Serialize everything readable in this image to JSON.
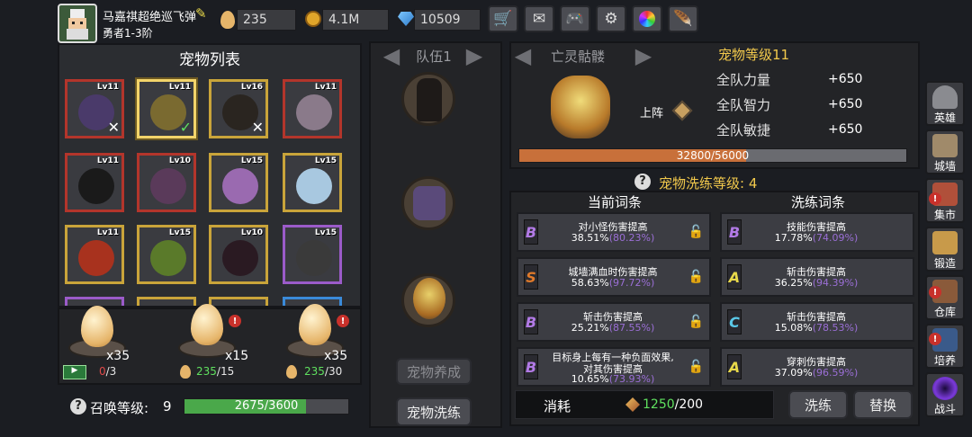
{
  "player": {
    "name": "马嘉祺超绝巡飞弹",
    "rank": "勇者1-3阶"
  },
  "currency": {
    "eggs": "235",
    "gold": "4.1M",
    "gems": "10509"
  },
  "toolbar_icons": [
    "shop-icon",
    "mail-icon",
    "gamepad-icon",
    "gear-icon",
    "shutter-icon",
    "feather-icon"
  ],
  "pet_list": {
    "title": "宠物列表",
    "slots": [
      {
        "level": "Lv11",
        "mark": "✕"
      },
      {
        "level": "Lv11",
        "mark": "✓"
      },
      {
        "level": "Lv16",
        "mark": "✕"
      },
      {
        "level": "Lv11",
        "mark": ""
      },
      {
        "level": "Lv11",
        "mark": ""
      },
      {
        "level": "Lv10",
        "mark": ""
      },
      {
        "level": "Lv15",
        "mark": ""
      },
      {
        "level": "Lv15",
        "mark": ""
      },
      {
        "level": "Lv11",
        "mark": ""
      },
      {
        "level": "Lv15",
        "mark": ""
      },
      {
        "level": "Lv10",
        "mark": ""
      },
      {
        "level": "Lv15",
        "mark": ""
      }
    ]
  },
  "summon": {
    "eggs": [
      {
        "count": "x35",
        "cost_current": "0",
        "cost_total": "/3"
      },
      {
        "count": "x15",
        "cost_current": "235",
        "cost_total": "/15"
      },
      {
        "count": "x35",
        "cost_current": "235",
        "cost_total": "/30"
      }
    ],
    "level_label": "召唤等级:",
    "level": "9",
    "xp": "2675/3600",
    "xp_fraction": 0.743
  },
  "team": {
    "title": "队伍1",
    "enhance_btn": "宠物养成",
    "reroll_btn": "宠物洗练"
  },
  "pet_detail": {
    "name": "亡灵骷髅",
    "level_label": "宠物等级11",
    "deploy": "上阵",
    "stats": [
      {
        "name": "全队力量",
        "value": "+650"
      },
      {
        "name": "全队智力",
        "value": "+650"
      },
      {
        "name": "全队敏捷",
        "value": "+650"
      }
    ],
    "xp": "32800/56000",
    "xp_fraction": 0.586
  },
  "reroll": {
    "level_label": "宠物洗练等级: 4",
    "current_header": "当前词条",
    "new_header": "洗练词条",
    "current": [
      {
        "grade": "B",
        "name": "对小怪伤害提高",
        "value": "38.51%",
        "max": "(80.23%)"
      },
      {
        "grade": "S",
        "name": "城墙满血时伤害提高",
        "value": "58.63%",
        "max": "(97.72%)"
      },
      {
        "grade": "B",
        "name": "斩击伤害提高",
        "value": "25.21%",
        "max": "(87.55%)"
      },
      {
        "grade": "B",
        "name": "目标身上每有一种负面效果,",
        "name2": "对其伤害提高",
        "value": "10.65%",
        "max": "(73.93%)"
      }
    ],
    "new": [
      {
        "grade": "B",
        "name": "技能伤害提高",
        "value": "17.78%",
        "max": "(74.09%)"
      },
      {
        "grade": "A",
        "name": "斩击伤害提高",
        "value": "36.25%",
        "max": "(94.39%)"
      },
      {
        "grade": "C",
        "name": "斩击伤害提高",
        "value": "15.08%",
        "max": "(78.53%)"
      },
      {
        "grade": "A",
        "name": "穿刺伤害提高",
        "value": "37.09%",
        "max": "(96.59%)"
      }
    ],
    "cost_label": "消耗",
    "cost_current": "1250",
    "cost_total": "/200",
    "reroll_btn": "洗练",
    "replace_btn": "替换"
  },
  "sidebar": [
    {
      "label": "英雄",
      "icon": "knight-helmet-icon",
      "badge": false
    },
    {
      "label": "城墙",
      "icon": "castle-icon",
      "badge": false
    },
    {
      "label": "集市",
      "icon": "market-icon",
      "badge": true
    },
    {
      "label": "锻造",
      "icon": "anvil-icon",
      "badge": false
    },
    {
      "label": "仓库",
      "icon": "warehouse-icon",
      "badge": true
    },
    {
      "label": "培养",
      "icon": "training-icon",
      "badge": true
    },
    {
      "label": "战斗",
      "icon": "battle-portal-icon",
      "badge": false
    }
  ],
  "colors": {
    "grade_B": "#8a55c9",
    "grade_S": "#e07a2a",
    "grade_A": "#d9c23a",
    "grade_C": "#3aa7c9",
    "xp_green": "#4aa84a",
    "xp_orange": "#c8703a",
    "gold_text": "#f2c94c"
  }
}
